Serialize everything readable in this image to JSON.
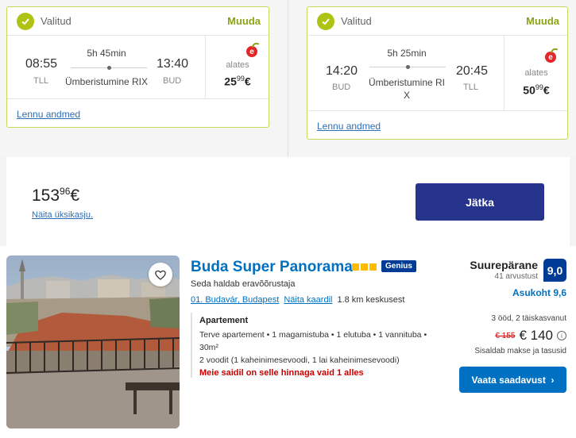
{
  "flights": [
    {
      "status_label": "Valitud",
      "modify_label": "Muuda",
      "depart_time": "08:55",
      "depart_airport": "TLL",
      "arrive_time": "13:40",
      "arrive_airport": "BUD",
      "duration": "5h 45min",
      "via": "Ümberistumine RIX",
      "from_label": "alates",
      "price_main": "25",
      "price_cents": "99",
      "price_currency": "€",
      "airline_icon": "e",
      "details_link": "Lennu andmed"
    },
    {
      "status_label": "Valitud",
      "modify_label": "Muuda",
      "depart_time": "14:20",
      "depart_airport": "BUD",
      "arrive_time": "20:45",
      "arrive_airport": "TLL",
      "duration": "5h 25min",
      "via": "Ümberistumine RI X",
      "from_label": "alates",
      "price_main": "50",
      "price_cents": "99",
      "price_currency": "€",
      "airline_icon": "e",
      "details_link": "Lennu andmed"
    }
  ],
  "total": {
    "price_main": "153",
    "price_cents": "96",
    "currency": "€",
    "single_price_link": "Näita üksikasju.",
    "continue_label": "Jätka"
  },
  "hotel": {
    "name": "Buda Super Panorama",
    "star_count": 3,
    "genius_label": "Genius",
    "managed_by": "Seda haldab eravõõrustaja",
    "location_link": "01. Budavár, Budapest",
    "map_link": "Näita kaardil",
    "distance": "1.8 km keskusest",
    "unit_type": "Apartement",
    "unit_desc": "Terve apartement • 1 magamistuba • 1 elutuba • 1 vannituba • 30m²",
    "beds": "2 voodit (1 kaheinimesevoodi, 1 lai kaheinimesevoodi)",
    "warning": "Meie saidil on selle hinnaga vaid 1 alles",
    "rating_label": "Suurepärane",
    "review_count": "41 arvustust",
    "score": "9,0",
    "location_score": "Asukoht 9,6",
    "stay_info": "3 ööd, 2 täiskasvanut",
    "old_price": "€ 155",
    "new_price": "€ 140",
    "taxes_note": "Sisaldab makse ja tasusid",
    "availability_button": "Vaata saadavust",
    "colors": {
      "brand_blue": "#0071c2",
      "accent_green": "#aec314",
      "dark_blue": "#003b95"
    }
  }
}
